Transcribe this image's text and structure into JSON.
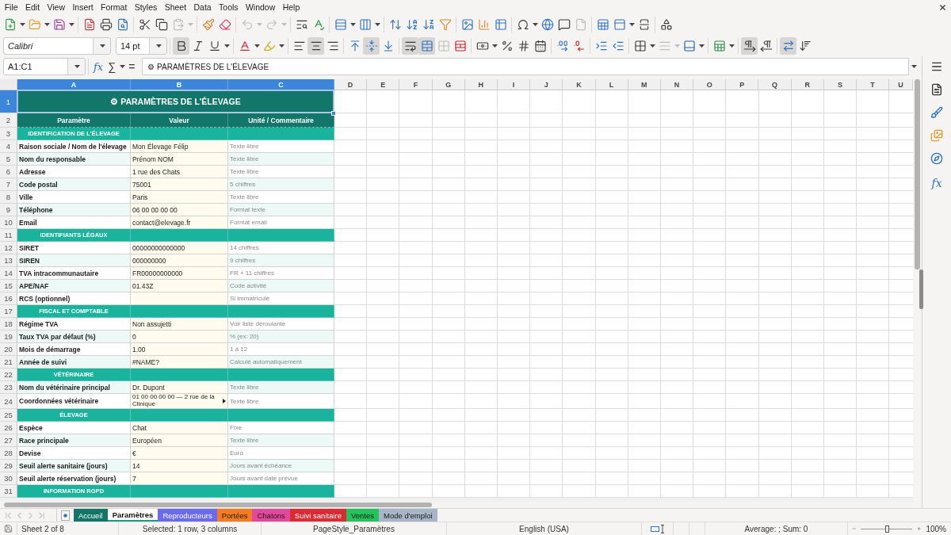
{
  "menu_bar": [
    "File",
    "Edit",
    "View",
    "Insert",
    "Format",
    "Styles",
    "Sheet",
    "Data",
    "Tools",
    "Window",
    "Help"
  ],
  "standard_toolbar": {
    "paste": {
      "disabled": true
    },
    "undo": {
      "disabled": true
    },
    "redo": {
      "disabled": true
    },
    "page": {
      "disabled": true
    }
  },
  "formatting_toolbar": {
    "font_name": "Calibri",
    "font_size": "14 pt",
    "bold": {
      "active": true
    },
    "italic": {
      "active": false
    },
    "underline": {
      "active": false
    },
    "align_left": {
      "active": false
    },
    "align_center": {
      "active": true
    },
    "align_right": {
      "active": false
    },
    "align_top": {
      "active": false
    },
    "align_middle": {
      "active": true
    },
    "align_bottom": {
      "active": false
    },
    "wrap_text": {
      "active": true
    },
    "merge_and_center": {
      "active": true
    },
    "merge_cells": {
      "disabled": true
    },
    "border_style": {
      "disabled": true
    },
    "left_to_right": {
      "active": true
    },
    "right_to_left": {
      "active": false
    },
    "text_orientation": {
      "active": true
    },
    "vertical_text": {
      "active": false
    }
  },
  "formula_bar": {
    "name_box": "A1:C1",
    "function_wizard": "fx",
    "sum": "∑",
    "equals": "=",
    "content": "⚙ PARAMÈTRES DE L'ÉLEVAGE"
  },
  "sheet": {
    "column_headers": [
      {
        "label": "A",
        "selected": true
      },
      {
        "label": "B",
        "selected": true
      },
      {
        "label": "C",
        "selected": true
      },
      {
        "label": "D",
        "selected": false
      },
      {
        "label": "E",
        "selected": false
      },
      {
        "label": "F",
        "selected": false
      },
      {
        "label": "G",
        "selected": false
      },
      {
        "label": "H",
        "selected": false
      },
      {
        "label": "I",
        "selected": false
      },
      {
        "label": "J",
        "selected": false
      },
      {
        "label": "K",
        "selected": false
      },
      {
        "label": "L",
        "selected": false
      },
      {
        "label": "M",
        "selected": false
      },
      {
        "label": "N",
        "selected": false
      },
      {
        "label": "O",
        "selected": false
      },
      {
        "label": "P",
        "selected": false
      },
      {
        "label": "Q",
        "selected": false
      },
      {
        "label": "R",
        "selected": false
      },
      {
        "label": "S",
        "selected": false
      },
      {
        "label": "T",
        "selected": false
      },
      {
        "label": "U",
        "selected": false
      }
    ],
    "rows": [
      {
        "number": "1",
        "selected": true,
        "kind": "title",
        "text": "⚙ PARAMÈTRES DE L'ÉLEVAGE"
      },
      {
        "number": "2",
        "selected": false,
        "kind": "header",
        "cells": [
          "Paramètre",
          "Valeur",
          "Unité / Commentaire"
        ]
      },
      {
        "number": "3",
        "selected": false,
        "kind": "section",
        "label": "IDENTIFICATION DE L'ÉLEVAGE"
      },
      {
        "number": "4",
        "selected": false,
        "kind": "field",
        "shaded": false,
        "parameter": "Raison sociale / Nom de l'élevage",
        "value": "Mon Élevage Félip",
        "comment": "Texte libre"
      },
      {
        "number": "5",
        "selected": false,
        "kind": "field",
        "shaded": true,
        "parameter": "Nom du responsable",
        "value": "Prénom NOM",
        "comment": "Texte libre"
      },
      {
        "number": "6",
        "selected": false,
        "kind": "field",
        "shaded": false,
        "parameter": "Adresse",
        "value": "1 rue des Chats",
        "comment": "Texte libre"
      },
      {
        "number": "7",
        "selected": false,
        "kind": "field",
        "shaded": true,
        "parameter": "Code postal",
        "value": "75001",
        "comment": "5 chiffres"
      },
      {
        "number": "8",
        "selected": false,
        "kind": "field",
        "shaded": false,
        "parameter": "Ville",
        "value": "Paris",
        "comment": "Texte libre"
      },
      {
        "number": "9",
        "selected": false,
        "kind": "field",
        "shaded": true,
        "parameter": "Téléphone",
        "value": "06 00 00 00 00",
        "comment": "Format texte"
      },
      {
        "number": "10",
        "selected": false,
        "kind": "field",
        "shaded": false,
        "parameter": "Email",
        "value": "contact@elevage.fr",
        "comment": "Format email"
      },
      {
        "number": "11",
        "selected": false,
        "kind": "section",
        "label": "IDENTIFIANTS LÉGAUX"
      },
      {
        "number": "12",
        "selected": false,
        "kind": "field",
        "shaded": false,
        "parameter": "SIRET",
        "value": "00000000000000",
        "comment": "14 chiffres"
      },
      {
        "number": "13",
        "selected": false,
        "kind": "field",
        "shaded": true,
        "parameter": "SIREN",
        "value": "000000000",
        "comment": "9 chiffres"
      },
      {
        "number": "14",
        "selected": false,
        "kind": "field",
        "shaded": false,
        "parameter": "TVA intracommunautaire",
        "value": "FR00000000000",
        "comment": "FR + 11 chiffres"
      },
      {
        "number": "15",
        "selected": false,
        "kind": "field",
        "shaded": true,
        "parameter": "APE/NAF",
        "value": "01.43Z",
        "comment": "Code activité"
      },
      {
        "number": "16",
        "selected": false,
        "kind": "field",
        "shaded": false,
        "parameter": "RCS (optionnel)",
        "comment": "Si immatriculé"
      },
      {
        "number": "17",
        "selected": false,
        "kind": "section",
        "label": "FISCAL ET COMPTABLE"
      },
      {
        "number": "18",
        "selected": false,
        "kind": "field",
        "shaded": false,
        "parameter": "Régime TVA",
        "value": "Non assujetti",
        "comment": "Voir liste déroulante"
      },
      {
        "number": "19",
        "selected": false,
        "kind": "field",
        "shaded": true,
        "parameter": "Taux TVA par défaut (%)",
        "value": "0",
        "comment": "% (ex: 20)"
      },
      {
        "number": "20",
        "selected": false,
        "kind": "field",
        "shaded": false,
        "parameter": "Mois de démarrage",
        "value": "1.00",
        "comment": "1 à 12"
      },
      {
        "number": "21",
        "selected": false,
        "kind": "field",
        "shaded": true,
        "parameter": "Année de suivi",
        "value": "#NAME?",
        "comment": "Calculé automatiquement"
      },
      {
        "number": "22",
        "selected": false,
        "kind": "section",
        "label": "VÉTÉRINAIRE"
      },
      {
        "number": "23",
        "selected": false,
        "kind": "field",
        "shaded": true,
        "parameter": "Nom du vétérinaire principal",
        "value": "Dr. Dupont",
        "comment": "Texte libre"
      },
      {
        "number": "24",
        "selected": false,
        "kind": "field",
        "shaded": false,
        "clipped": true,
        "parameter": "Coordonnées vétérinaire",
        "value": "01 00 00 00 00 — 2 rue de la Clinique",
        "comment": "Texte libre"
      },
      {
        "number": "25",
        "selected": false,
        "kind": "section",
        "label": "ÉLEVAGE"
      },
      {
        "number": "26",
        "selected": false,
        "kind": "field",
        "shaded": false,
        "parameter": "Espèce",
        "value": "Chat",
        "comment": "Fixe"
      },
      {
        "number": "27",
        "selected": false,
        "kind": "field",
        "shaded": true,
        "parameter": "Race principale",
        "value": "Européen",
        "comment": "Texte libre"
      },
      {
        "number": "28",
        "selected": false,
        "kind": "field",
        "shaded": false,
        "parameter": "Devise",
        "value": "€",
        "comment": "Euro"
      },
      {
        "number": "29",
        "selected": false,
        "kind": "field",
        "shaded": true,
        "parameter": "Seuil alerte sanitaire (jours)",
        "value": "14",
        "comment": "Jours avant échéance"
      },
      {
        "number": "30",
        "selected": false,
        "kind": "field",
        "shaded": false,
        "parameter": "Seuil alerte réservation (jours)",
        "value": "7",
        "comment": "Jours avant date prévue"
      },
      {
        "number": "31",
        "selected": false,
        "kind": "section",
        "label": "INFORMATION RGPD"
      }
    ]
  },
  "sidebar": {
    "functions": "fx"
  },
  "tab_navigation": {
    "disabled": true
  },
  "sheet_tabs": [
    {
      "label": "Accueil",
      "selected": false,
      "color": "#137566"
    },
    {
      "label": "Paramètres",
      "selected": true,
      "color": "#1a9c88"
    },
    {
      "label": "Reproducteurs",
      "selected": false,
      "color": "#6a6aee"
    },
    {
      "label": "Portées",
      "selected": false,
      "color": "#f47b20"
    },
    {
      "label": "Chatons",
      "selected": false,
      "color": "#e4489c"
    },
    {
      "label": "Suivi sanitaire",
      "selected": false,
      "color": "#dc2a35"
    },
    {
      "label": "Ventes",
      "selected": false,
      "color": "#23c25b"
    },
    {
      "label": "Mode d'emploi",
      "selected": false,
      "color": "#a8b5c7"
    }
  ],
  "status_bar": {
    "sheet": "Sheet 2 of 8",
    "selection": "Selected: 1 row, 3 columns",
    "page_style": "PageStyle_Paramètres",
    "language": "English (USA)",
    "statistics": "Average: ; Sum: 0",
    "zoom": {
      "level": 0.5,
      "reading": "100%"
    }
  }
}
